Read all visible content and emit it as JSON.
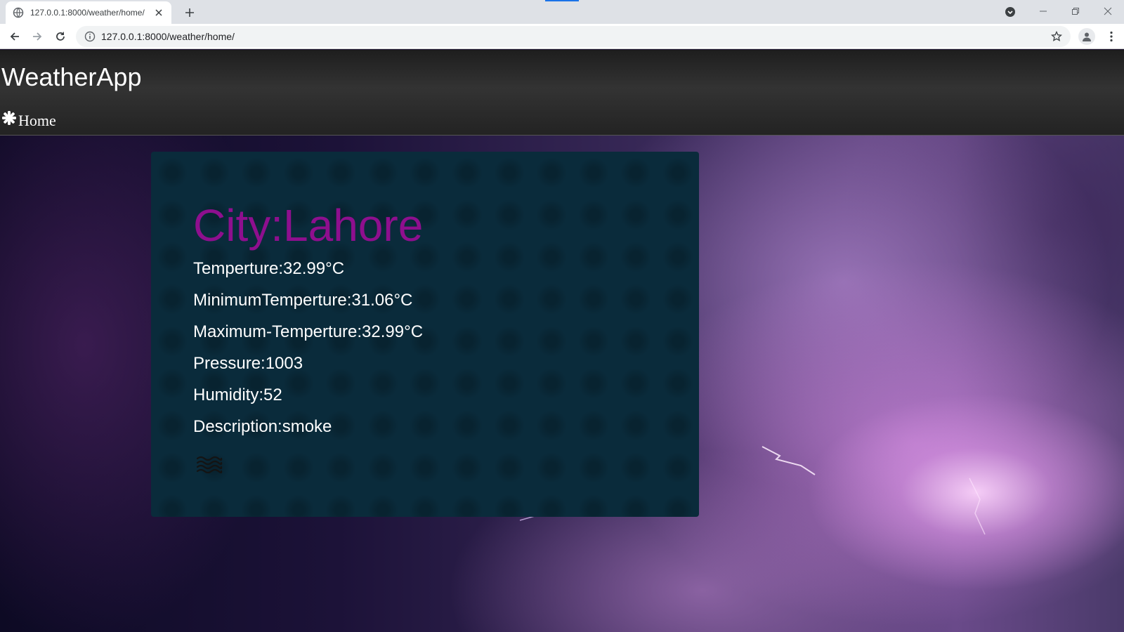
{
  "browser": {
    "tab_title": "127.0.0.1:8000/weather/home/",
    "url": "127.0.0.1:8000/weather/home/",
    "icons": [
      "globe-icon",
      "close-icon",
      "plus-icon",
      "tab-search-icon",
      "minimize-icon",
      "restore-icon",
      "window-close-icon",
      "back-arrow-icon",
      "forward-arrow-icon",
      "reload-icon",
      "info-icon",
      "star-icon",
      "profile-icon",
      "more-vert-icon"
    ]
  },
  "navbar": {
    "brand": "WeatherApp",
    "home_label": "Home",
    "home_icon": "gear-icon"
  },
  "weather": {
    "city": "City:Lahore",
    "temperature": "Temperture:32.99°C",
    "min_temperature": "MinimumTemperture:31.06°C",
    "max_temperature": "Maximum-Temperture:32.99°C",
    "pressure": "Pressure:1003",
    "humidity": "Humidity:52",
    "description": "Description:smoke",
    "icon": "mist-icon"
  },
  "colors": {
    "city_text": "#8e0f8e",
    "card_bg": "#0a2b3b",
    "navbar_bg": "#2a2a2a",
    "tab_accent": "#1a73e8"
  }
}
